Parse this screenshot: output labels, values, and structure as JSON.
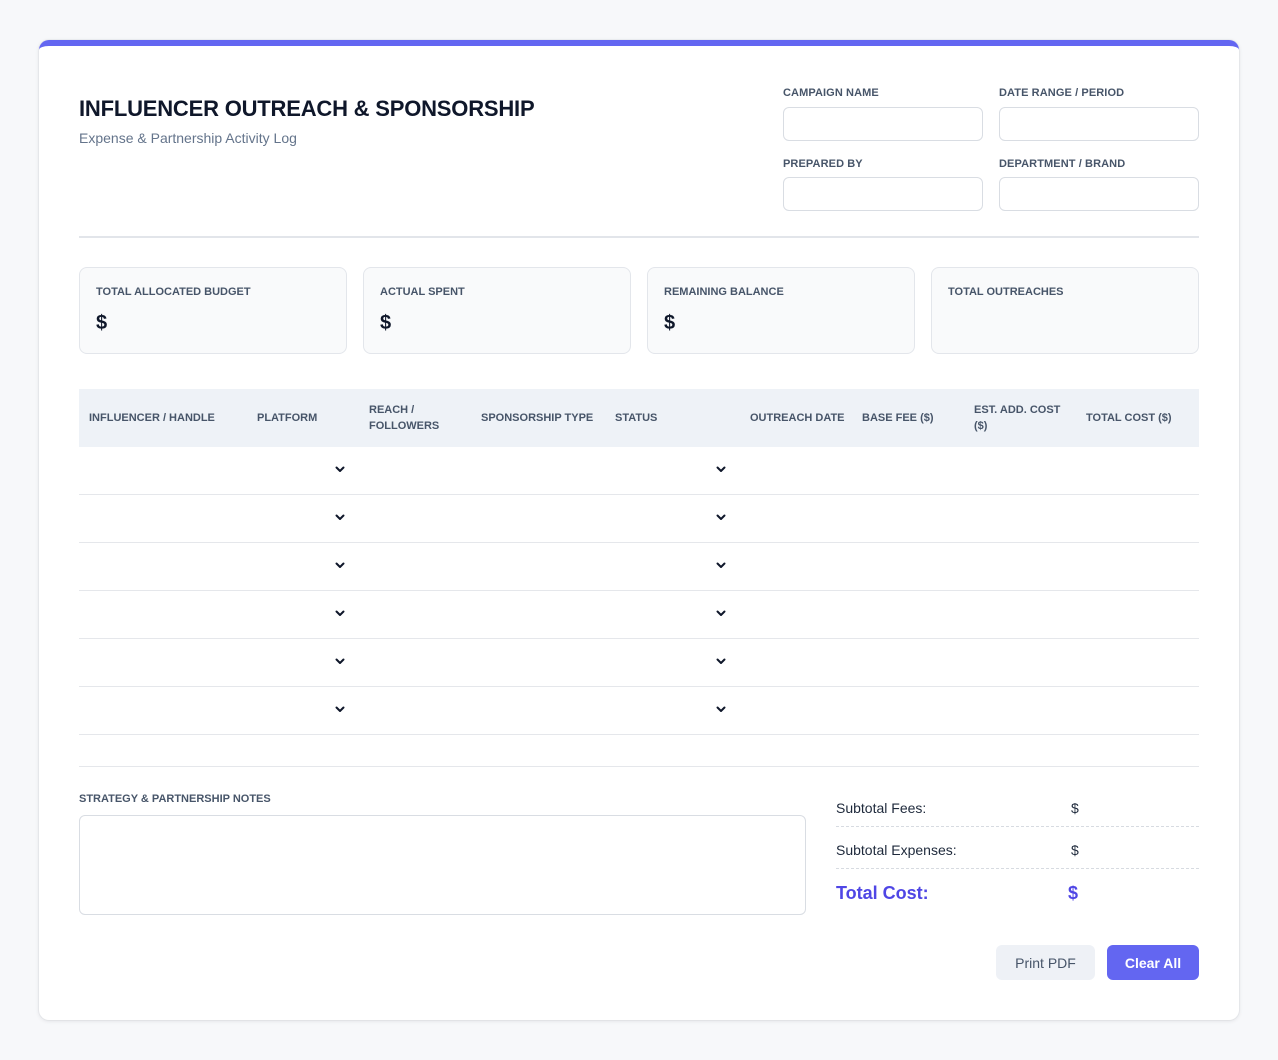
{
  "header": {
    "title": "INFLUENCER OUTREACH & SPONSORSHIP",
    "subtitle": "Expense & Partnership Activity Log"
  },
  "meta": {
    "campaign_name_label": "CAMPAIGN NAME",
    "campaign_name_value": "",
    "date_range_label": "DATE RANGE / PERIOD",
    "date_range_value": "",
    "prepared_by_label": "PREPARED BY",
    "prepared_by_value": "",
    "department_label": "DEPARTMENT / BRAND",
    "department_value": ""
  },
  "summary": [
    {
      "label": "TOTAL ALLOCATED BUDGET",
      "value": "$"
    },
    {
      "label": "ACTUAL SPENT",
      "value": "$"
    },
    {
      "label": "REMAINING BALANCE",
      "value": "$"
    },
    {
      "label": "TOTAL OUTREACHES",
      "value": ""
    }
  ],
  "table": {
    "columns": [
      "INFLUENCER / HANDLE",
      "PLATFORM",
      "REACH /\nFOLLOWERS",
      "SPONSORSHIP TYPE",
      "STATUS",
      "OUTREACH DATE",
      "BASE FEE ($)",
      "EST. ADD. COST\n($)",
      "TOTAL COST ($)"
    ],
    "rows": [
      {
        "influencer": "",
        "platform": "",
        "reach": "",
        "type": "",
        "status": "",
        "date": "",
        "base_fee": "",
        "add_cost": "",
        "total": ""
      },
      {
        "influencer": "",
        "platform": "",
        "reach": "",
        "type": "",
        "status": "",
        "date": "",
        "base_fee": "",
        "add_cost": "",
        "total": ""
      },
      {
        "influencer": "",
        "platform": "",
        "reach": "",
        "type": "",
        "status": "",
        "date": "",
        "base_fee": "",
        "add_cost": "",
        "total": ""
      },
      {
        "influencer": "",
        "platform": "",
        "reach": "",
        "type": "",
        "status": "",
        "date": "",
        "base_fee": "",
        "add_cost": "",
        "total": ""
      },
      {
        "influencer": "",
        "platform": "",
        "reach": "",
        "type": "",
        "status": "",
        "date": "",
        "base_fee": "",
        "add_cost": "",
        "total": ""
      },
      {
        "influencer": "",
        "platform": "",
        "reach": "",
        "type": "",
        "status": "",
        "date": "",
        "base_fee": "",
        "add_cost": "",
        "total": ""
      }
    ]
  },
  "notes": {
    "label": "STRATEGY & PARTNERSHIP NOTES",
    "value": ""
  },
  "totals": {
    "subtotal_fees_label": "Subtotal Fees:",
    "subtotal_fees_value": "$",
    "subtotal_expenses_label": "Subtotal Expenses:",
    "subtotal_expenses_value": "$",
    "total_cost_label": "Total Cost:",
    "total_cost_value": "$"
  },
  "buttons": {
    "print_label": "Print PDF",
    "clear_label": "Clear All"
  },
  "colors": {
    "accent": "#6366f1",
    "accent_text": "#4f46e5"
  },
  "icons": {
    "dropdown": "chevron-down-icon"
  }
}
